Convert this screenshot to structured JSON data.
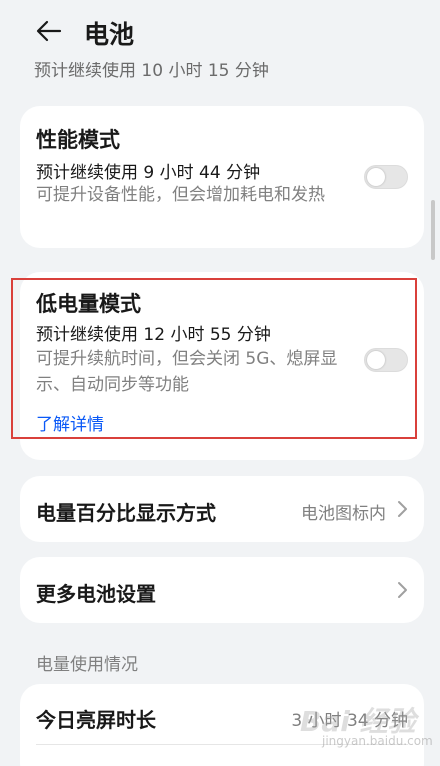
{
  "header": {
    "title": "电池"
  },
  "scrolled_text": "预计继续使用 10 小时 15 分钟",
  "performance_mode": {
    "title": "性能模式",
    "estimate": "预计继续使用 9 小时 44 分钟",
    "description": "可提升设备性能，但会增加耗电和发热",
    "enabled": false
  },
  "low_power_mode": {
    "title": "低电量模式",
    "estimate": "预计继续使用 12 小时 55 分钟",
    "description": "可提升续航时间，但会关闭 5G、熄屏显示、自动同步等功能",
    "learn_more": "了解详情",
    "enabled": false
  },
  "battery_percent": {
    "label": "电量百分比显示方式",
    "value": "电池图标内"
  },
  "more_settings": {
    "label": "更多电池设置"
  },
  "usage_section": {
    "label": "电量使用情况"
  },
  "screen_time": {
    "label": "今日亮屏时长",
    "value": "3 小时 34 分钟"
  },
  "watermark": {
    "main": "Bai 经验",
    "sub": "jingyan.baidu.com"
  },
  "colors": {
    "accent_link": "#0a59f7",
    "highlight_border": "#d9403b",
    "background": "#f1f3f5"
  }
}
